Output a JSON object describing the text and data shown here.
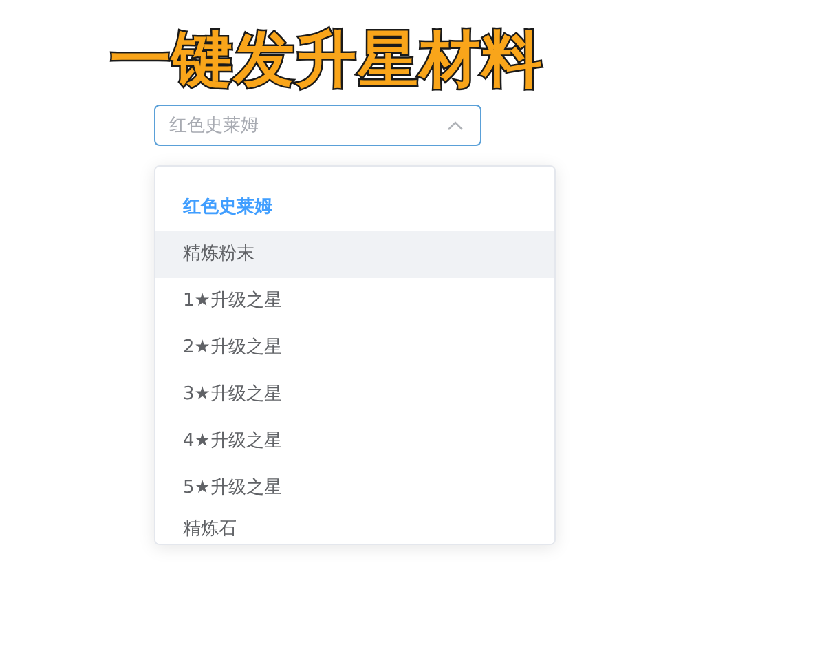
{
  "caption": "一键发升星材料",
  "select": {
    "placeholder": "红色史莱姆",
    "expanded": true
  },
  "options": [
    {
      "label": "红色史莱姆",
      "selected": true,
      "hovered": false
    },
    {
      "label": "精炼粉末",
      "selected": false,
      "hovered": true
    },
    {
      "label": "1★升级之星",
      "selected": false,
      "hovered": false
    },
    {
      "label": "2★升级之星",
      "selected": false,
      "hovered": false
    },
    {
      "label": "3★升级之星",
      "selected": false,
      "hovered": false
    },
    {
      "label": "4★升级之星",
      "selected": false,
      "hovered": false
    },
    {
      "label": "5★升级之星",
      "selected": false,
      "hovered": false
    },
    {
      "label": "精炼石",
      "selected": false,
      "hovered": false
    }
  ]
}
